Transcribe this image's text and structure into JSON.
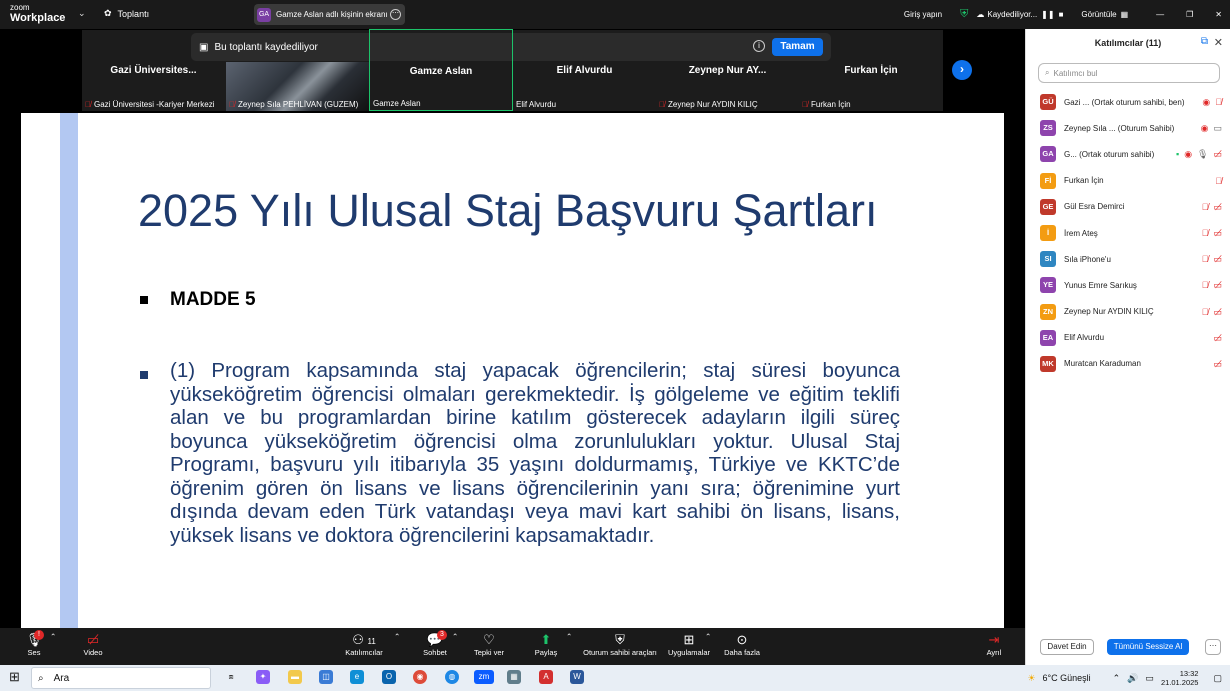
{
  "topbar": {
    "logo_line1": "zoom",
    "logo_line2": "Workplace",
    "meeting_label": "Toplantı",
    "share_initials": "GA",
    "share_text": "Gamze Aslan adlı kişinin ekranı",
    "sign_in": "Giriş yapın",
    "recording": "Kaydediliyor...",
    "view": "Görüntüle"
  },
  "recording_banner": {
    "text": "Bu toplantı kaydediliyor",
    "ok_label": "Tamam"
  },
  "tiles": [
    {
      "name": "Gazi Üniversites...",
      "label": "Gazi Üniversitesi -Kariyer Merkezi",
      "muted": true
    },
    {
      "name": "",
      "label": "Zeynep Sıla PEHLİVAN (GUZEM)",
      "muted": true
    },
    {
      "name": "Gamze Aslan",
      "label": "Gamze Aslan",
      "muted": false
    },
    {
      "name": "Elif Alvurdu",
      "label": "Elif Alvurdu",
      "muted": false
    },
    {
      "name": "Zeynep Nur AY...",
      "label": "Zeynep Nur AYDIN KILIÇ",
      "muted": true
    },
    {
      "name": "Furkan İçin",
      "label": "Furkan İçin",
      "muted": true
    }
  ],
  "slide": {
    "title": "2025 Yılı Ulusal Staj Başvuru Şartları",
    "bullet1": "MADDE 5",
    "bullet2": "(1) Program kapsamında staj yapacak öğrencilerin; staj süresi boyunca yükseköğretim öğrencisi olmaları gerekmektedir. İş gölgeleme ve eğitim teklifi alan ve bu programlardan birine katılım gösterecek adayların ilgili süreç boyunca yükseköğretim öğrencisi olma zorunlulukları yoktur. Ulusal Staj Programı, başvuru yılı itibarıyla 35 yaşını doldurmamış, Türkiye ve KKTC’de öğrenim gören ön lisans ve lisans öğrencilerinin yanı sıra; öğrenimine yurt dışında devam eden Türk vatandaşı veya mavi kart sahibi ön lisans, lisans, yüksek lisans ve doktora öğrencilerini kapsamaktadır."
  },
  "controls": {
    "audio": "Ses",
    "video": "Video",
    "participants": "Katılımcılar",
    "participants_count": "11",
    "chat": "Sohbet",
    "chat_badge": "3",
    "react": "Tepki ver",
    "share": "Paylaş",
    "host_tools": "Oturum sahibi araçları",
    "apps": "Uygulamalar",
    "more": "Daha fazla",
    "leave": "Ayrıl"
  },
  "panel": {
    "title": "Katılımcılar (11)",
    "search_placeholder": "Katılımcı bul",
    "participants": [
      {
        "initials": "GÜ",
        "name": "Gazi ... (Ortak oturum sahibi, ben)",
        "color": "#c0392b"
      },
      {
        "initials": "ZS",
        "name": "Zeynep Sıla ... (Oturum Sahibi)",
        "color": "#8e44ad"
      },
      {
        "initials": "GA",
        "name": "G... (Ortak oturum sahibi)",
        "color": "#8e44ad"
      },
      {
        "initials": "Fİ",
        "name": "Furkan İçin",
        "color": "#f39c12"
      },
      {
        "initials": "GE",
        "name": "Gül Esra Demirci",
        "color": "#c0392b"
      },
      {
        "initials": "İ",
        "name": "İrem Ateş",
        "color": "#f39c12"
      },
      {
        "initials": "SI",
        "name": "Sıla iPhone'u",
        "color": "#2e86c1"
      },
      {
        "initials": "YE",
        "name": "Yunus Emre Sarıkuş",
        "color": "#8e44ad"
      },
      {
        "initials": "ZN",
        "name": "Zeynep Nur AYDIN KILIÇ",
        "color": "#f39c12"
      },
      {
        "initials": "EA",
        "name": "Elif Alvurdu",
        "color": "#8e44ad"
      },
      {
        "initials": "MK",
        "name": "Muratcan Karaduman",
        "color": "#c0392b"
      }
    ],
    "invite": "Davet Edin",
    "mute_all": "Tümünü Sessize Al"
  },
  "taskbar": {
    "search": "Ara",
    "weather": "6°C Güneşli",
    "time": "13:32",
    "date": "21.01.2025"
  }
}
